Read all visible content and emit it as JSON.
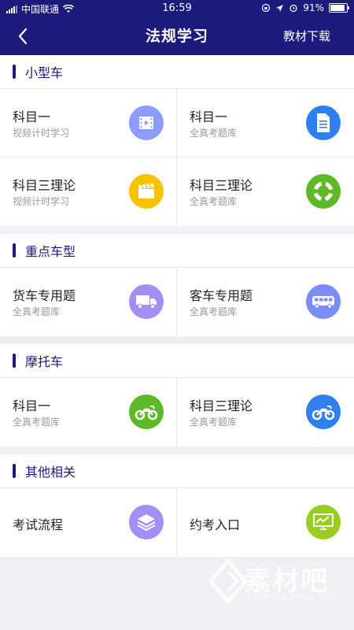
{
  "status_bar": {
    "carrier": "中国联通",
    "time": "16:59",
    "battery": "91%",
    "battery_level": 0.91
  },
  "nav": {
    "title": "法规学习",
    "action": "教材下载"
  },
  "sections": [
    {
      "title": "小型车",
      "items": [
        {
          "title": "科目一",
          "subtitle": "视频计时学习",
          "icon": "video-icon",
          "color": "#8f9cff"
        },
        {
          "title": "科目一",
          "subtitle": "全真考题库",
          "icon": "document-icon",
          "color": "#2f7ff0"
        },
        {
          "title": "科目三理论",
          "subtitle": "视频计时学习",
          "icon": "clapperboard-icon",
          "color": "#f7c300"
        },
        {
          "title": "科目三理论",
          "subtitle": "全真考题库",
          "icon": "lifebuoy-icon",
          "color": "#5fb828"
        }
      ]
    },
    {
      "title": "重点车型",
      "items": [
        {
          "title": "货车专用题",
          "subtitle": "全真考题库",
          "icon": "truck-icon",
          "color": "#a48ef5"
        },
        {
          "title": "客车专用题",
          "subtitle": "全真考题库",
          "icon": "bus-icon",
          "color": "#7a8dfa"
        }
      ]
    },
    {
      "title": "摩托车",
      "items": [
        {
          "title": "科目一",
          "subtitle": "全真考题库",
          "icon": "motorcycle-icon",
          "color": "#5fb828"
        },
        {
          "title": "科目三理论",
          "subtitle": "全真考题库",
          "icon": "motorcycle-icon",
          "color": "#2f7ff0"
        }
      ]
    },
    {
      "title": "其他相关",
      "items": [
        {
          "title": "考试流程",
          "icon": "layers-icon",
          "color": "#a48ef5"
        },
        {
          "title": "约考入口",
          "icon": "monitor-chart-icon",
          "color": "#9acd20"
        }
      ]
    }
  ],
  "watermark": {
    "brand": "素材吧",
    "url": "WWW.SUCAIBAR.COM"
  }
}
